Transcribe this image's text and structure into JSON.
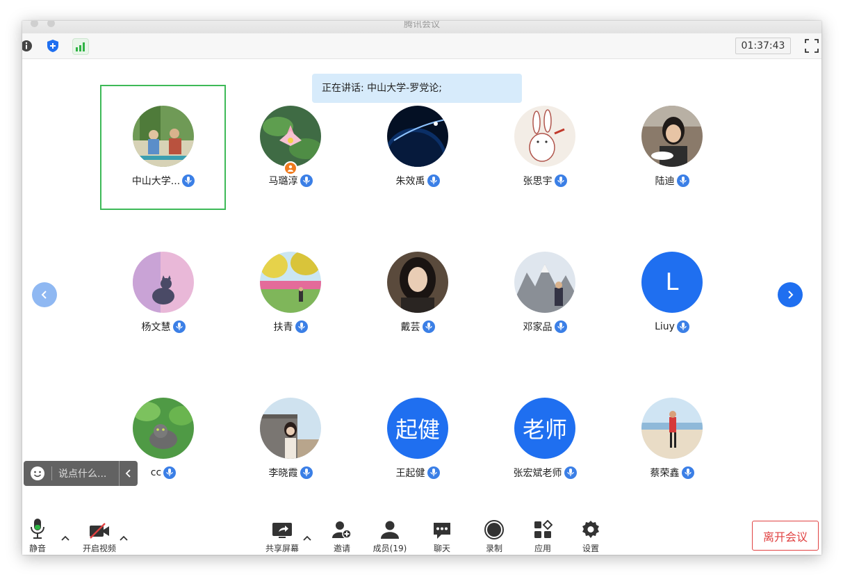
{
  "window": {
    "title": "腾讯会议"
  },
  "topbar": {
    "info_icon": "info-icon",
    "security_icon": "shield-plus-icon",
    "signal_icon": "signal-bars-icon",
    "timer": "01:37:43",
    "fullscreen_icon": "fullscreen-icon"
  },
  "speaking": {
    "text": "正在讲话: 中山大学-罗党论;"
  },
  "participants": [
    {
      "name": "中山大学...",
      "avatar": "photo-outdoor-people",
      "active": true
    },
    {
      "name": "马璐淳",
      "avatar": "photo-lotus",
      "host": true
    },
    {
      "name": "朱效禹",
      "avatar": "photo-space"
    },
    {
      "name": "张思宇",
      "avatar": "photo-rabbit-drawing"
    },
    {
      "name": "陆迪",
      "avatar": "photo-woman-eating"
    },
    {
      "name": "杨文慧",
      "avatar": "photo-cat-pink"
    },
    {
      "name": "扶青",
      "avatar": "photo-garden"
    },
    {
      "name": "戴芸",
      "avatar": "photo-woman-portrait"
    },
    {
      "name": "邓家品",
      "avatar": "photo-mountain"
    },
    {
      "name": "Liuy",
      "avatar_text": "L",
      "avatar_color": "#1f6ff0"
    },
    {
      "name": "cc",
      "avatar": "photo-cat-leaves"
    },
    {
      "name": "李晓霞",
      "avatar": "photo-woman-wall"
    },
    {
      "name": "王起健",
      "avatar_text": "起健",
      "avatar_color": "#1f6ff0"
    },
    {
      "name": "张宏斌老师",
      "avatar_text": "老师",
      "avatar_color": "#1f6ff0"
    },
    {
      "name": "蔡荣鑫",
      "avatar": "photo-beach-runner"
    }
  ],
  "chat": {
    "placeholder": "说点什么...",
    "emoji_icon": "smiley-icon",
    "collapse_icon": "chevron-left-icon"
  },
  "nav": {
    "prev_icon": "chevron-left-icon",
    "next_icon": "chevron-right-icon"
  },
  "toolbar": {
    "mute": "静音",
    "video": "开启视频",
    "share": "共享屏幕",
    "invite": "邀请",
    "members": "成员(19)",
    "chat": "聊天",
    "record": "录制",
    "apps": "应用",
    "settings": "设置",
    "leave": "离开会议"
  },
  "colors": {
    "accent": "#1f6ff0",
    "active_border": "#3db957",
    "leave": "#e04141",
    "mic_badge": "#3b7fe6"
  }
}
